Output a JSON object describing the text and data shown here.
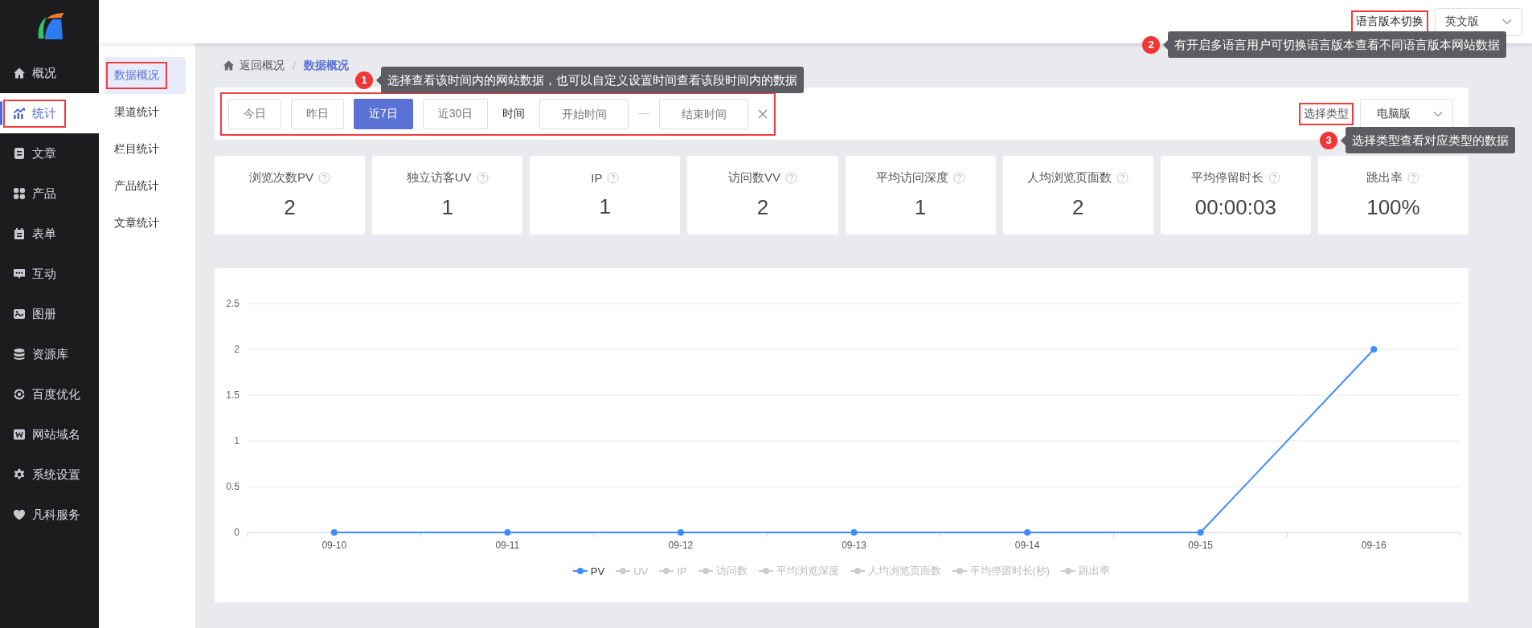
{
  "sidebar": {
    "items": [
      {
        "label": "概况",
        "selected": false,
        "highlighted": false
      },
      {
        "label": "统计",
        "selected": true,
        "highlighted": true
      },
      {
        "label": "文章",
        "selected": false,
        "highlighted": false
      },
      {
        "label": "产品",
        "selected": false,
        "highlighted": false
      },
      {
        "label": "表单",
        "selected": false,
        "highlighted": false
      },
      {
        "label": "互动",
        "selected": false,
        "highlighted": false
      },
      {
        "label": "图册",
        "selected": false,
        "highlighted": false
      },
      {
        "label": "资源库",
        "selected": false,
        "highlighted": false
      },
      {
        "label": "百度优化",
        "selected": false,
        "highlighted": false
      },
      {
        "label": "网站域名",
        "selected": false,
        "highlighted": false
      },
      {
        "label": "系统设置",
        "selected": false,
        "highlighted": false
      },
      {
        "label": "凡科服务",
        "selected": false,
        "highlighted": false
      }
    ]
  },
  "subnav": {
    "items": [
      {
        "label": "数据概况",
        "selected": true,
        "highlighted": true
      },
      {
        "label": "渠道统计",
        "selected": false,
        "highlighted": false
      },
      {
        "label": "栏目统计",
        "selected": false,
        "highlighted": false
      },
      {
        "label": "产品统计",
        "selected": false,
        "highlighted": false
      },
      {
        "label": "文章统计",
        "selected": false,
        "highlighted": false
      }
    ]
  },
  "top_bar": {
    "language_label": {
      "text": "语言版本切换",
      "highlighted": true
    },
    "language_select": {
      "value": "英文版"
    }
  },
  "breadcrumb": {
    "items": [
      {
        "label": "返回概况",
        "current": false
      },
      {
        "label": "数据概况",
        "current": true
      }
    ],
    "separator": "/"
  },
  "filters": {
    "highlighted": true,
    "ranges": [
      {
        "label": "今日",
        "selected": false
      },
      {
        "label": "昨日",
        "selected": false
      },
      {
        "label": "近7日",
        "selected": true
      },
      {
        "label": "近30日",
        "selected": false
      }
    ],
    "time_label": "时间",
    "start": {
      "placeholder": "开始时间"
    },
    "end": {
      "placeholder": "结束时间"
    },
    "type_label": {
      "text": "选择类型",
      "highlighted": true
    },
    "type_select": {
      "value": "电脑版"
    }
  },
  "stats": [
    {
      "label": "浏览次数PV",
      "value": "2"
    },
    {
      "label": "独立访客UV",
      "value": "1"
    },
    {
      "label": "IP",
      "value": "1"
    },
    {
      "label": "访问数VV",
      "value": "2"
    },
    {
      "label": "平均访问深度",
      "value": "1"
    },
    {
      "label": "人均浏览页面数",
      "value": "2"
    },
    {
      "label": "平均停留时长",
      "value": "00:00:03"
    },
    {
      "label": "跳出率",
      "value": "100%"
    }
  ],
  "chart": {
    "chart_data": {
      "type": "line",
      "categories": [
        "09-10",
        "09-11",
        "09-12",
        "09-13",
        "09-14",
        "09-15",
        "09-16"
      ],
      "series": [
        {
          "name": "PV",
          "color": "#3d8bff",
          "marker": "circle",
          "values": [
            0,
            0,
            0,
            0,
            0,
            0,
            2
          ]
        }
      ],
      "ylim": [
        0,
        2.5
      ],
      "yticks": [
        0,
        0.5,
        1,
        1.5,
        2,
        2.5
      ],
      "grid": true
    },
    "legend": [
      {
        "label": "UV",
        "selected": false
      },
      {
        "label": "IP",
        "selected": false
      },
      {
        "label": "访问数",
        "selected": false
      },
      {
        "label": "平均浏览深度",
        "selected": false
      },
      {
        "label": "人均浏览页面数",
        "selected": false
      },
      {
        "label": "平均停留时长(秒)",
        "selected": false
      },
      {
        "label": "跳出率",
        "selected": false
      }
    ]
  },
  "annotations": [
    {
      "number": "1",
      "text": "选择查看该时间内的网站数据，也可以自定义设置时间查看该段时间内的数据"
    },
    {
      "number": "2",
      "text": "有开启多语言用户可切换语言版本查看不同语言版本网站数据"
    },
    {
      "number": "3",
      "text": "选择类型查看对应类型的数据"
    }
  ]
}
